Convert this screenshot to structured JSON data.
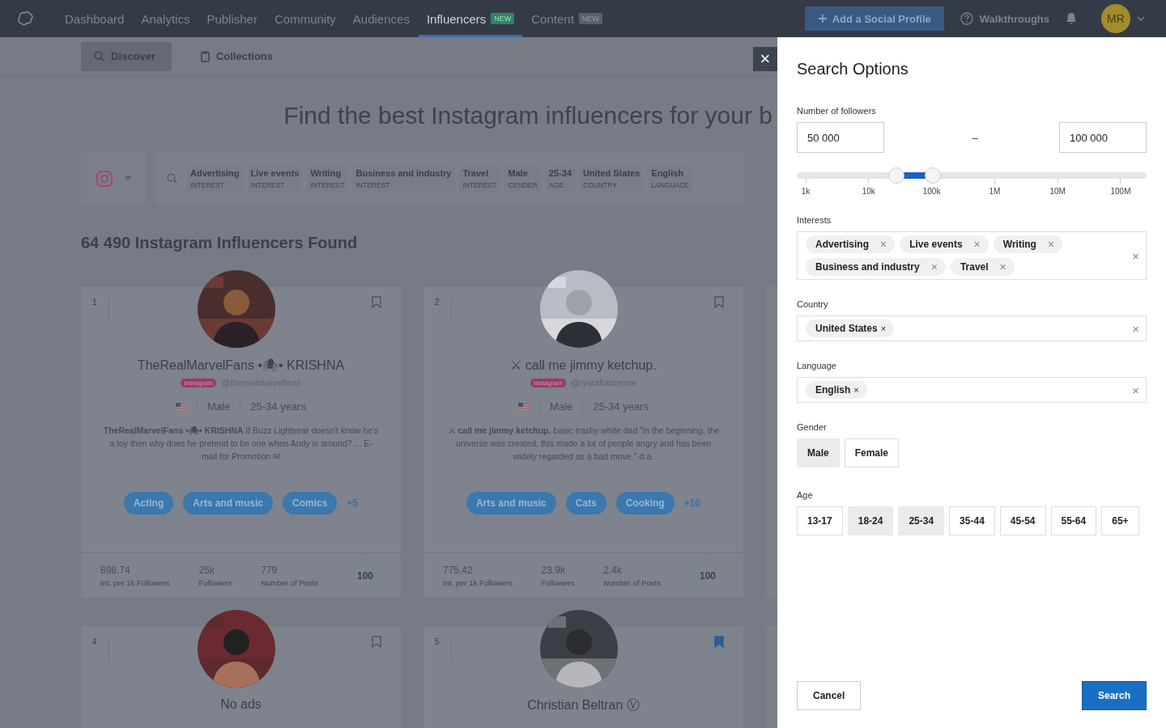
{
  "nav": {
    "items": [
      {
        "label": "Dashboard",
        "selected": false
      },
      {
        "label": "Analytics",
        "selected": false
      },
      {
        "label": "Publisher",
        "selected": false
      },
      {
        "label": "Community",
        "selected": false
      },
      {
        "label": "Audiences",
        "selected": false
      },
      {
        "label": "Influencers",
        "selected": true,
        "badge": "NEW",
        "color": "#2e8566"
      },
      {
        "label": "Content",
        "selected": false,
        "badge": "NEW",
        "color": "#59606c"
      }
    ],
    "add_button": "Add a Social Profile",
    "walkthroughs": "Walkthroughs",
    "avatar": "MR"
  },
  "subnav": [
    {
      "label": "Discover",
      "selected": true
    },
    {
      "label": "Collections",
      "selected": false
    }
  ],
  "close": "×",
  "headline": "Find the best Instagram influencers for your b",
  "filters": [
    {
      "label": "Advertising",
      "type": "INTEREST"
    },
    {
      "label": "Live events",
      "type": "INTEREST"
    },
    {
      "label": "Writing",
      "type": "INTEREST"
    },
    {
      "label": "Business and industry",
      "type": "INTEREST"
    },
    {
      "label": "Travel",
      "type": "INTEREST"
    },
    {
      "label": "Male",
      "type": "GENDER"
    },
    {
      "label": "25-34",
      "type": "AGE"
    },
    {
      "label": "United States",
      "type": "COUNTRY"
    },
    {
      "label": "English",
      "type": "LANGUAGE"
    }
  ],
  "results_title": "64 490 Instagram Influencers Found",
  "cards": [
    {
      "rank": "1",
      "name": "TheRealMarvelFans •🕷• KRISHNA",
      "platform": "Instagram",
      "handle": "@therealmarvelfans",
      "gender": "Male",
      "age": "25-34 years",
      "bio": "**TheRealMarvelFans •🕷• KRISHNA** If Buzz Lightyear doesn't know he's a toy then why does he pretend to be one when Andy is around? ... E-mail for Promotion ✉",
      "tags": [
        "Acting",
        "Arts and music",
        "Comics"
      ],
      "more": "+5",
      "stats": [
        {
          "value": "898.74",
          "label": "Int. per 1k Followers"
        },
        {
          "value": "25k",
          "label": "Followers"
        },
        {
          "value": "779",
          "label": "Number of Posts"
        }
      ],
      "score": "100",
      "bookmarked": false
    },
    {
      "rank": "2",
      "name": "⚔ call me jimmy ketchup.",
      "platform": "Instagram",
      "handle": "@ryanthatmeme",
      "gender": "Male",
      "age": "25-34 years",
      "bio": "⚔ **call me jimmy ketchup.** basic trashy white dad \"in the beginning, the universe was created. this made a lot of people angry and has been widely regarded as a bad move.\"-d.a.",
      "tags": [
        "Arts and music",
        "Cats",
        "Cooking"
      ],
      "more": "+10",
      "stats": [
        {
          "value": "775.42",
          "label": "Int. per 1k Followers"
        },
        {
          "value": "23.9k",
          "label": "Followers"
        },
        {
          "value": "2.4k",
          "label": "Number of Posts"
        }
      ],
      "score": "100",
      "bookmarked": false
    },
    {
      "rank": "4",
      "name": "No ads",
      "bookmarked": false
    },
    {
      "rank": "5",
      "name": "Christian Beltran Ⓥ",
      "bookmarked": true
    }
  ],
  "search_options": {
    "title": "Search Options",
    "followers": {
      "label": "Number of followers",
      "min": "50 000",
      "separator": "–",
      "max": "100 000",
      "thumbs": [
        {
          "level": 0.285
        },
        {
          "level": 0.39
        }
      ],
      "ticks": [
        "1k",
        "10k",
        "100k",
        "1M",
        "10M",
        "100M"
      ]
    },
    "interests": {
      "label": "Interests",
      "chips": [
        {
          "label": "Advertising",
          "remove": "×"
        },
        {
          "label": "Live events",
          "remove": "×"
        },
        {
          "label": "Writing",
          "remove": "×"
        },
        {
          "label": "Business and industry",
          "remove": "×"
        },
        {
          "label": "Travel",
          "remove": "×"
        }
      ],
      "clear": "×"
    },
    "country": {
      "label": "Country",
      "chips": [
        {
          "label": "United States",
          "remove": "×"
        }
      ],
      "clear": "×"
    },
    "language": {
      "label": "Language",
      "chips": [
        {
          "label": "English",
          "remove": "×"
        }
      ],
      "clear": "×"
    },
    "gender": {
      "label": "Gender",
      "options": [
        {
          "label": "Male",
          "selected": true
        },
        {
          "label": "Female",
          "selected": false
        }
      ]
    },
    "age": {
      "label": "Age",
      "options": [
        {
          "label": "13-17",
          "selected": false
        },
        {
          "label": "18-24",
          "selected": true
        },
        {
          "label": "25-34",
          "selected": true
        },
        {
          "label": "35-44",
          "selected": false
        },
        {
          "label": "45-54",
          "selected": false
        },
        {
          "label": "55-64",
          "selected": false
        },
        {
          "label": "65+",
          "selected": false
        }
      ]
    },
    "cancel": "Cancel",
    "search": "Search"
  }
}
